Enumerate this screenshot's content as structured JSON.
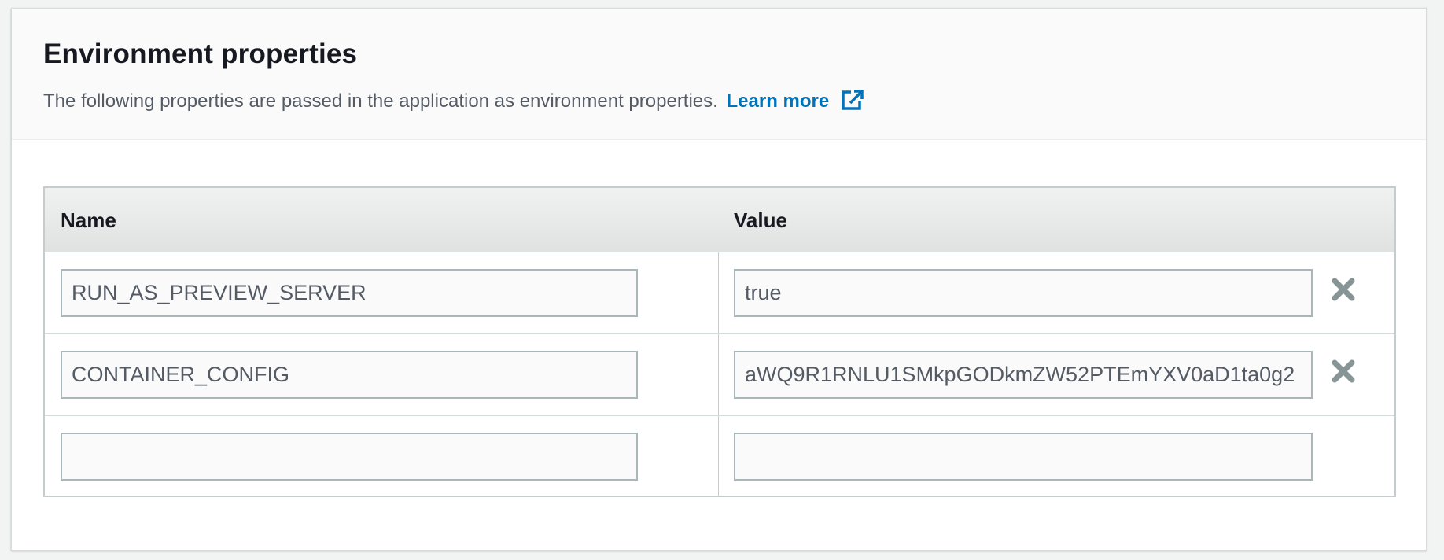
{
  "header": {
    "title": "Environment properties",
    "description": "The following properties are passed in the application as environment properties.",
    "learn_more_label": "Learn more",
    "learn_more_icon": "external-link-icon",
    "accent_color": "#0073bb"
  },
  "table": {
    "columns": [
      "Name",
      "Value"
    ],
    "rows": [
      {
        "name": "RUN_AS_PREVIEW_SERVER",
        "value": "true",
        "removable": true
      },
      {
        "name": "CONTAINER_CONFIG",
        "value": "aWQ9R1RNLU1SMkpGODkmZW52PTEmYXV0aD1ta0g2",
        "removable": true
      },
      {
        "name": "",
        "value": "",
        "removable": false
      }
    ],
    "remove_icon": "close-icon"
  }
}
